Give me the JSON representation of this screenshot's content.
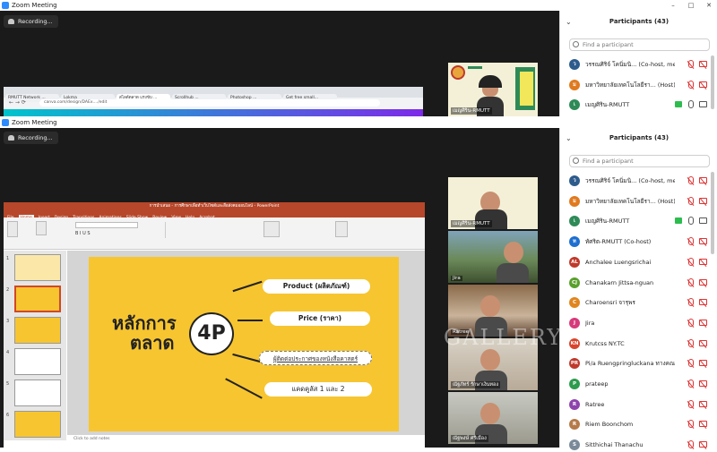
{
  "top_window": {
    "title": "Zoom Meeting",
    "recording": "Recording...",
    "browser_tabs": [
      "RMUTT Network ...",
      "Lokma",
      "สไลด์ตลาด แรงขับ ...",
      "Scrollhub ...",
      "Photoshop ...",
      "Get free small..."
    ],
    "address": "canva.com/design/DAEx..../edit",
    "thumb_name": "เมญศิริน-RMUTT",
    "participants": {
      "title": "Participants (43)",
      "search_placeholder": "Find a participant",
      "items": [
        {
          "name": "วรรณศิริจ์ โคนิ่มนิ... (Co-host, me)",
          "initial": "ว",
          "color": "#2d5b8c"
        },
        {
          "name": "มหาวิทยาลัยเทคโนโลยีรา... (Host)",
          "initial": "ม",
          "color": "#e07a1f"
        },
        {
          "name": "เมญศิริน-RMUTT",
          "initial": "เ",
          "color": "#2e8b57"
        }
      ]
    }
  },
  "bottom_window": {
    "title": "Zoom Meeting",
    "recording": "Recording...",
    "participants": {
      "title": "Participants (43)",
      "search_placeholder": "Find a participant",
      "items": [
        {
          "name": "วรรณศิริจ์ โคนิ่มนิ... (Co-host, me)",
          "initial": "ว",
          "color": "#2d5b8c"
        },
        {
          "name": "มหาวิทยาลัยเทคโนโลยีรา... (Host)",
          "initial": "ม",
          "color": "#e07a1f"
        },
        {
          "name": "เมญศิริน-RMUTT",
          "initial": "เ",
          "color": "#2e8b57"
        },
        {
          "name": "ทัศริต-RMUTT (Co-host)",
          "initial": "ท",
          "color": "#1e6fd0"
        },
        {
          "name": "Anchalee Luengsrichai",
          "initial": "AL",
          "color": "#c0392b"
        },
        {
          "name": "Chanakarn Jittsa-nguan",
          "initial": "CJ",
          "color": "#5aa02c"
        },
        {
          "name": "Charoensri จารุพร",
          "initial": "C",
          "color": "#e0861f"
        },
        {
          "name": "Jira",
          "initial": "J",
          "color": "#d63a7a"
        },
        {
          "name": "Krutcss NY.TC",
          "initial": "KN",
          "color": "#d9452c"
        },
        {
          "name": "Pi/a Ruengpringluckana ทางคณะกรรม",
          "initial": "PR",
          "color": "#c0392b"
        },
        {
          "name": "prateep",
          "initial": "P",
          "color": "#2e9b4d"
        },
        {
          "name": "Ratree",
          "initial": "R",
          "color": "#8e44ad"
        },
        {
          "name": "Riem Boonchom",
          "initial": "R",
          "color": "#b67a4a"
        },
        {
          "name": "Sitthichai Thanachu",
          "initial": "S",
          "color": "#7a8a99"
        }
      ]
    },
    "videos": [
      {
        "label": "เมญศิริน-RMUTT"
      },
      {
        "label": "Jira"
      },
      {
        "label": "Ratree"
      },
      {
        "label": "ณัฐภัทร์ รักษาเงินทอง"
      },
      {
        "label": "ณัฐพงษ์ ศรีเมือง"
      }
    ]
  },
  "powerpoint": {
    "title": "การนำเสนอ - การศึกษาเพื่อทำเว็บไซต์และสื่อสังคมออนไลน์ - PowerPoint",
    "tabs": [
      "File",
      "Home",
      "Insert",
      "Design",
      "Transitions",
      "Animations",
      "Slide Show",
      "Review",
      "View",
      "Help",
      "Acrobat"
    ],
    "slide": {
      "heading_line1": "หลักการ",
      "heading_line2": "ตลาด",
      "center": "4P",
      "items": [
        "Product (ผลิตภัณฑ์)",
        "Price (ราคา)",
        "ผู้ติดต่อประกาศของหนังสือคาสตร์",
        "แคดคูลัส 1 และ 2"
      ]
    },
    "notes": "Click to add notes",
    "slide_numbers": [
      "1",
      "2",
      "3",
      "4",
      "5",
      "6"
    ]
  },
  "watermark": "GALLERY",
  "colors": {
    "slide_bg": "#f7c52f",
    "ppt_red": "#b7472a",
    "zoom_dark": "#1a1a1a"
  }
}
